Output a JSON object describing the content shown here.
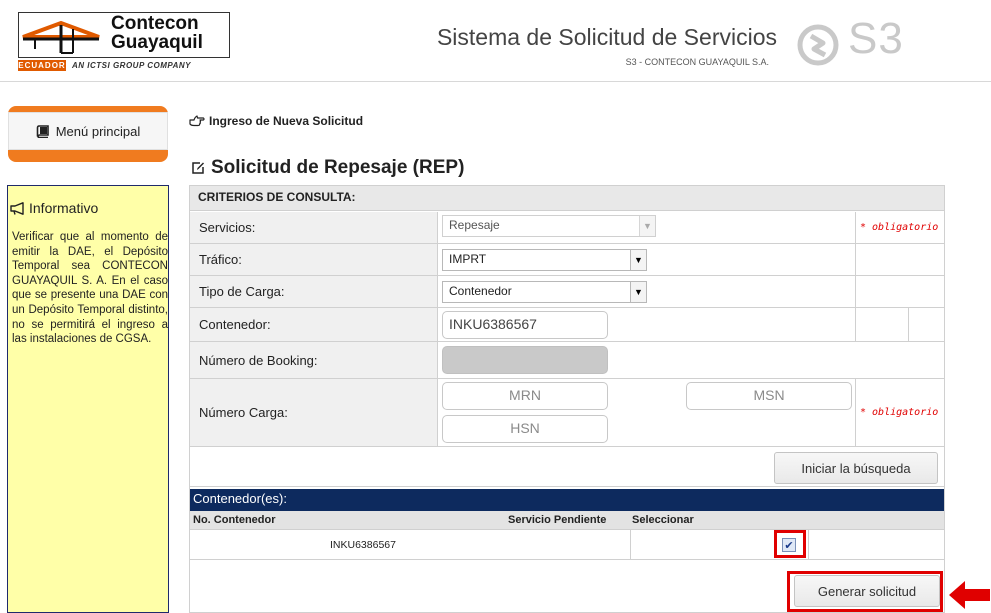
{
  "header": {
    "logo_line1": "Contecon",
    "logo_line2": "Guayaquil",
    "logo_country": "ECUADOR",
    "logo_group": "AN ICTSI GROUP COMPANY",
    "system_title": "Sistema de Solicitud de Servicios",
    "system_subtitle": "S3 - CONTECON GUAYAQUIL S.A.",
    "app_badge": "S3"
  },
  "sidebar": {
    "menu_label": "Menú principal",
    "menu_icon": "book-icon",
    "info_title": "Informativo",
    "info_icon": "megaphone-icon",
    "info_text": "Verificar que al momento de emitir la DAE, el Depósito Temporal sea CONTECON GUAYAQUIL S. A. En el caso que se presente una DAE con un Depósito Temporal distinto, no se permitirá el ingreso a las instalaciones de CGSA."
  },
  "main": {
    "breadcrumb": "Ingreso de Nueva Solicitud",
    "breadcrumb_icon": "hand-point-right-icon",
    "title": "Solicitud de Repesaje (REP)",
    "title_icon": "edit-icon",
    "criteria_header": "CRITERIOS DE CONSULTA:",
    "required_note": "* obligatorio",
    "fields": {
      "servicios_label": "Servicios:",
      "servicios_value": "Repesaje",
      "trafico_label": "Tráfico:",
      "trafico_value": "IMPRT",
      "tipo_carga_label": "Tipo de Carga:",
      "tipo_carga_value": "Contenedor",
      "contenedor_label": "Contenedor:",
      "contenedor_value": "INKU6386567",
      "booking_label": "Número de Booking:",
      "booking_value": "",
      "numero_carga_label": "Número Carga:",
      "mrn_placeholder": "MRN",
      "msn_placeholder": "MSN",
      "hsn_placeholder": "HSN"
    },
    "search_button": "Iniciar la búsqueda",
    "containers_header": "Contenedor(es):",
    "table": {
      "columns": [
        "No. Contenedor",
        "Servicio Pendiente",
        "Seleccionar"
      ],
      "rows": [
        {
          "contenedor": "INKU6386567",
          "servicio_pendiente": "",
          "seleccionado": true
        }
      ]
    },
    "generate_button": "Generar solicitud"
  },
  "colors": {
    "accent_orange": "#f07b1f",
    "navy_bar": "#0d2a5e",
    "info_bg": "#ffffa8",
    "required_red": "#e00000",
    "highlight_red": "#e00000"
  }
}
